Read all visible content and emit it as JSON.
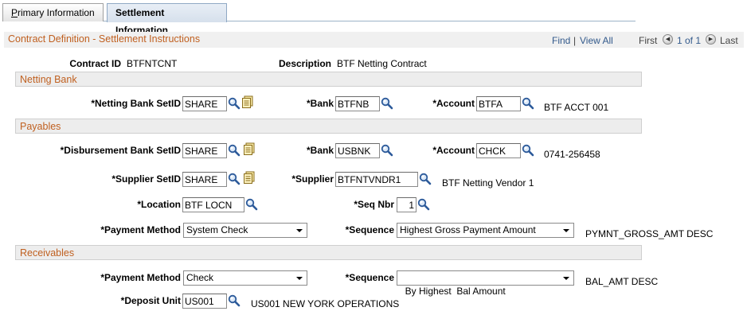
{
  "tabs": [
    {
      "label_prefix": "P",
      "label_rest": "rimary Information"
    },
    {
      "label": "Settlement Information"
    }
  ],
  "header": {
    "title": "Contract Definition - Settlement Instructions",
    "find": "Find",
    "sep": "|",
    "view_all": "View All",
    "first": "First",
    "count": "1 of 1",
    "last": "Last"
  },
  "contract": {
    "id_label": "Contract ID",
    "id_value": "BTFNTCNT",
    "desc_label": "Description",
    "desc_value": "BTF Netting Contract"
  },
  "netting_bank": {
    "title": "Netting Bank",
    "setid_label": "*Netting Bank SetID",
    "setid_value": "SHARE",
    "bank_label": "*Bank",
    "bank_value": "BTFNB",
    "account_label": "*Account",
    "account_value": "BTFA",
    "account_desc": "BTF ACCT 001"
  },
  "payables": {
    "title": "Payables",
    "disb_setid_label": "*Disbursement Bank SetID",
    "disb_setid_value": "SHARE",
    "bank_label": "*Bank",
    "bank_value": "USBNK",
    "account_label": "*Account",
    "account_value": "CHCK",
    "account_desc": "0741-256458",
    "supplier_setid_label": "*Supplier SetID",
    "supplier_setid_value": "SHARE",
    "supplier_label": "*Supplier",
    "supplier_value": "BTFNTVNDR1",
    "supplier_desc": "BTF Netting Vendor 1",
    "location_label": "*Location",
    "location_value": "BTF LOCN",
    "seq_nbr_label": "*Seq Nbr",
    "seq_nbr_value": "1",
    "payment_method_label": "*Payment Method",
    "payment_method_value": "System Check",
    "sequence_label": "*Sequence",
    "sequence_value": "Highest Gross Payment Amount",
    "sequence_desc": "PYMNT_GROSS_AMT DESC"
  },
  "receivables": {
    "title": "Receivables",
    "payment_method_label": "*Payment Method",
    "payment_method_value": "Check",
    "sequence_label": "*Sequence",
    "sequence_value": "By Highest  Bal Amount",
    "sequence_desc": "BAL_AMT DESC",
    "deposit_unit_label": "*Deposit Unit",
    "deposit_unit_value": "US001",
    "deposit_unit_desc": "US001 NEW YORK OPERATIONS"
  },
  "icons": {
    "lookup": "magnifier-lookup-icon",
    "setid_list": "setid-list-icon",
    "nav_prev": "previous-arrow-icon",
    "nav_next": "next-arrow-icon"
  },
  "colors": {
    "section_title": "#c06020",
    "link": "#335a8c",
    "section_bg": "#ededed"
  }
}
